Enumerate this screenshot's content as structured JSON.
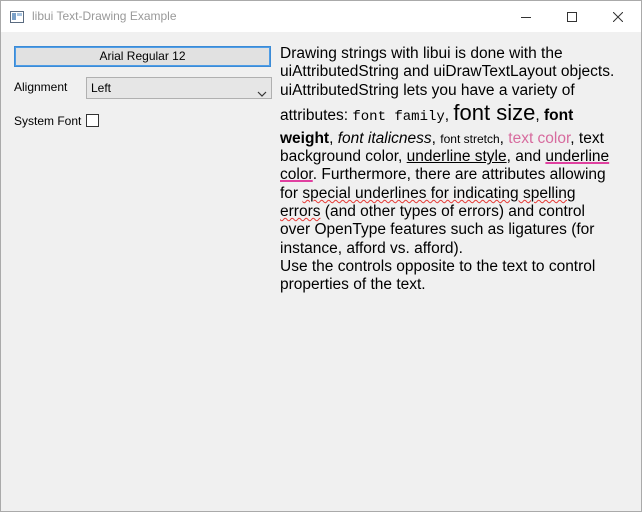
{
  "window": {
    "title": "libui Text-Drawing Example"
  },
  "controls": {
    "font_button_label": "Arial Regular 12",
    "alignment_label": "Alignment",
    "alignment_value": "Left",
    "system_font_label": "System Font",
    "system_font_checked": false
  },
  "text": {
    "l1": "Drawing strings with libui is done with the",
    "l2": "uiAttributedString and uiDrawTextLayout objects.",
    "l3": "uiAttributedString lets you have a variety of",
    "l4a": "attributes: ",
    "l4b": "font family",
    "l4c": ", ",
    "l4d": "font size",
    "l4e": ", ",
    "l4f": "font",
    "l5a": "weight",
    "l5b": ", ",
    "l5c": "font italicness",
    "l5d": ", ",
    "l5e": "font stretch",
    "l5f": ", ",
    "l5g": "text color",
    "l5h": ", text",
    "l6a": "background color, ",
    "l6b": "underline style",
    "l6c": ", and ",
    "l6d": "underline",
    "l7a": "color",
    "l7b": ". Furthermore, there are attributes allowing",
    "l8a": "for ",
    "l8b": "special underlines for indicating spelling",
    "l9a": "errors",
    "l9b": " (and other types of errors) and control",
    "l10": "over OpenType features such as ligatures (for",
    "l11": "instance, afford vs. afford).",
    "l12": "Use the controls opposite to the text to control",
    "l13": "properties of the text."
  }
}
